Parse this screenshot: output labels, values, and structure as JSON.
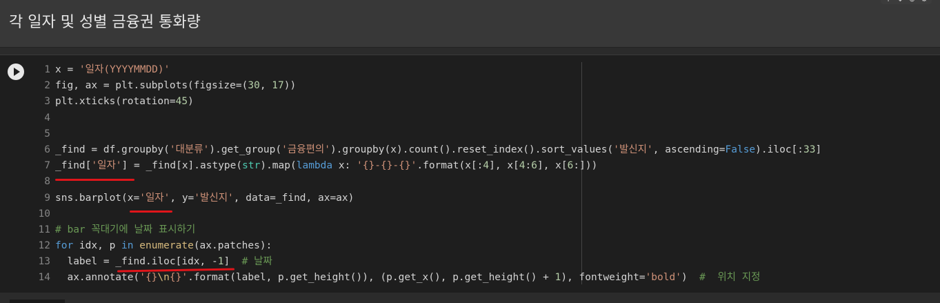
{
  "heading": "각 일자 및 성별 금융권 통화량",
  "code_lines": [
    {
      "n": "1",
      "parts": [
        [
          "x = ",
          ""
        ],
        [
          "'일자(YYYYMMDD)'",
          "str"
        ]
      ]
    },
    {
      "n": "2",
      "parts": [
        [
          "fig, ax = plt.subplots(figsize=(",
          ""
        ],
        [
          "30",
          "num"
        ],
        [
          ", ",
          ""
        ],
        [
          "17",
          "num"
        ],
        [
          "))",
          ""
        ]
      ]
    },
    {
      "n": "3",
      "parts": [
        [
          "plt.xticks(rotation=",
          ""
        ],
        [
          "45",
          "num"
        ],
        [
          ")",
          ""
        ]
      ]
    },
    {
      "n": "4",
      "parts": []
    },
    {
      "n": "5",
      "parts": []
    },
    {
      "n": "6",
      "parts": [
        [
          "_find = df.groupby(",
          ""
        ],
        [
          "'대분류'",
          "str"
        ],
        [
          ").get_group(",
          ""
        ],
        [
          "'금융편의'",
          "str"
        ],
        [
          ").groupby(x).count().reset_index().sort_values(",
          ""
        ],
        [
          "'발신지'",
          "str"
        ],
        [
          ", ascending=",
          ""
        ],
        [
          "False",
          "kw"
        ],
        [
          ").iloc[:",
          ""
        ],
        [
          "33",
          "num"
        ],
        [
          "]",
          ""
        ]
      ]
    },
    {
      "n": "7",
      "parts": [
        [
          "_find[",
          ""
        ],
        [
          "'일자'",
          "str"
        ],
        [
          "] = _find[x].astype(",
          ""
        ],
        [
          "str",
          "bi"
        ],
        [
          ").map(",
          ""
        ],
        [
          "lambda",
          "kw"
        ],
        [
          " x: ",
          ""
        ],
        [
          "'{}-{}-{}'",
          "str"
        ],
        [
          ".format(x[:",
          ""
        ],
        [
          "4",
          "num"
        ],
        [
          "], x[",
          ""
        ],
        [
          "4",
          "num"
        ],
        [
          ":",
          ""
        ],
        [
          "6",
          "num"
        ],
        [
          "], x[",
          ""
        ],
        [
          "6",
          "num"
        ],
        [
          ":]))",
          ""
        ]
      ]
    },
    {
      "n": "8",
      "parts": []
    },
    {
      "n": "9",
      "parts": [
        [
          "sns.barplot(x=",
          ""
        ],
        [
          "'일자'",
          "str"
        ],
        [
          ", y=",
          ""
        ],
        [
          "'발신지'",
          "str"
        ],
        [
          ", data=_find, ax=ax)",
          ""
        ]
      ]
    },
    {
      "n": "10",
      "parts": []
    },
    {
      "n": "11",
      "parts": [
        [
          "# bar 꼭대기에 날짜 표시하기",
          "cm"
        ]
      ]
    },
    {
      "n": "12",
      "parts": [
        [
          "for",
          "kw"
        ],
        [
          " idx, p ",
          ""
        ],
        [
          "in",
          "kw"
        ],
        [
          " ",
          ""
        ],
        [
          "enumerate",
          "esc"
        ],
        [
          "(ax.patches):",
          ""
        ]
      ]
    },
    {
      "n": "13",
      "parts": [
        [
          "  label = _find.iloc[idx, -",
          ""
        ],
        [
          "1",
          "num"
        ],
        [
          "]  ",
          ""
        ],
        [
          "# 날짜",
          "cm"
        ]
      ]
    },
    {
      "n": "14",
      "parts": [
        [
          "  ax.annotate(",
          ""
        ],
        [
          "'{}",
          "str"
        ],
        [
          "\\n",
          "esc"
        ],
        [
          "{}'",
          "str"
        ],
        [
          ".format(label, p.get_height()), (p.get_x(), p.get_height() + ",
          ""
        ],
        [
          "1",
          "num"
        ],
        [
          "), fontweight=",
          ""
        ],
        [
          "'bold'",
          "str"
        ],
        [
          ")  ",
          ""
        ],
        [
          "#  위치 지정",
          "cm"
        ]
      ]
    }
  ],
  "annotations": [
    "red-underline-line7",
    "red-underline-line9",
    "red-underline-line13-14"
  ],
  "icons": {
    "run": "play-icon"
  }
}
